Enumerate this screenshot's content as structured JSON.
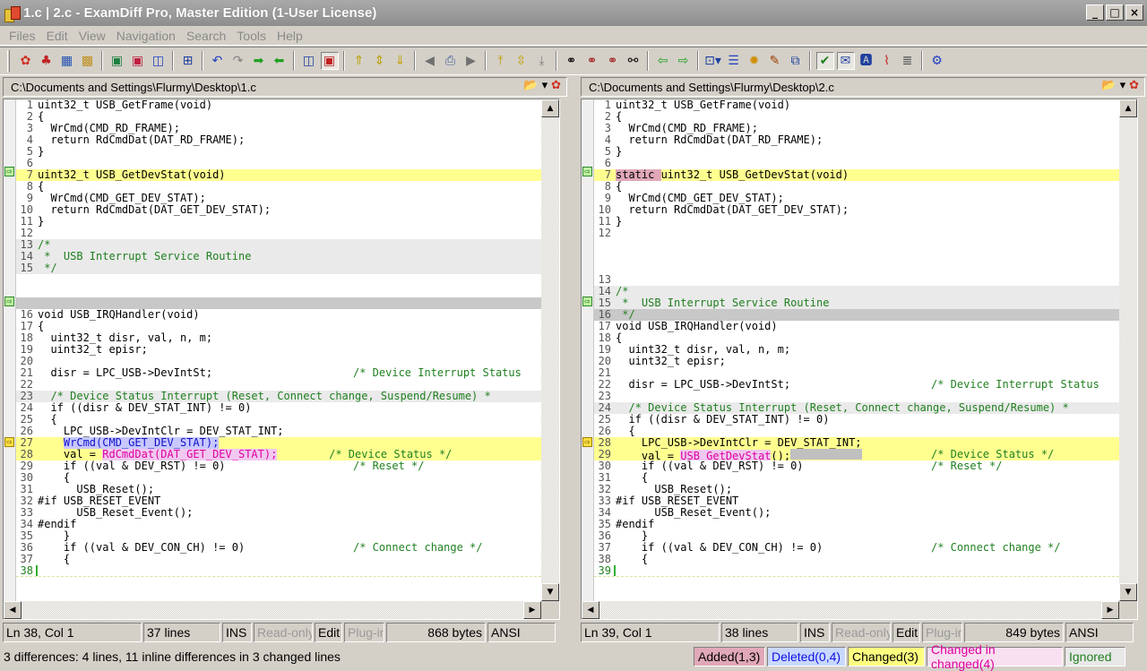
{
  "window": {
    "title": "1.c  |  2.c - ExamDiff Pro, Master Edition (1-User License)",
    "controls": {
      "minimize": "_",
      "maximize": "□",
      "close": "×"
    }
  },
  "menu": [
    "Files",
    "Edit",
    "View",
    "Navigation",
    "Search",
    "Tools",
    "Help"
  ],
  "toolbar_icons": [
    "compare-icon",
    "recompare-icon",
    "open-files-icon",
    "open-dirs-icon",
    "save-icon",
    "save-as-icon",
    "save-both-icon",
    "view-options-icon",
    "undo-icon",
    "redo-icon",
    "copy-right-icon",
    "copy-left-icon",
    "two-panes-icon",
    "one-pane-icon",
    "first-diff-icon",
    "current-diff-icon",
    "next-diff-bottom-icon",
    "prev-icon",
    "print-icon",
    "next-icon",
    "top-icon",
    "center-icon",
    "bottom-icon",
    "find-icon",
    "find-next-icon",
    "find-prev-icon",
    "replace-icon",
    "go-left-icon",
    "go-right-icon",
    "options-dropdown-icon",
    "lines-icon",
    "settings-icon",
    "edit-icon",
    "plugin-icon",
    "check-icon",
    "comment-icon",
    "font-icon",
    "whitespace-icon",
    "filter-icon",
    "config-icon"
  ],
  "left": {
    "path": "C:\\Documents and Settings\\Flurmy\\Desktop\\1.c",
    "lines": [
      {
        "n": "1",
        "t": "uint32_t USB_GetFrame(void)"
      },
      {
        "n": "2",
        "t": "{"
      },
      {
        "n": "3",
        "t": "  WrCmd(CMD_RD_FRAME);"
      },
      {
        "n": "4",
        "t": "  return RdCmdDat(DAT_RD_FRAME);"
      },
      {
        "n": "5",
        "t": "}"
      },
      {
        "n": "6",
        "t": ""
      },
      {
        "n": "7",
        "t": "uint32_t USB_GetDevStat(void)"
      },
      {
        "n": "8",
        "t": "{"
      },
      {
        "n": "9",
        "t": "  WrCmd(CMD_GET_DEV_STAT);"
      },
      {
        "n": "10",
        "t": "  return RdCmdDat(DAT_GET_DEV_STAT);"
      },
      {
        "n": "11",
        "t": "}"
      },
      {
        "n": "12",
        "t": ""
      },
      {
        "n": "13",
        "t": "/*"
      },
      {
        "n": "14",
        "t": " *  USB Interrupt Service Routine"
      },
      {
        "n": "15",
        "t": " */"
      },
      {
        "n": "16",
        "t": "void USB_IRQHandler(void)"
      },
      {
        "n": "17",
        "t": "{"
      },
      {
        "n": "18",
        "t": "  uint32_t disr, val, n, m;"
      },
      {
        "n": "19",
        "t": "  uint32_t episr;"
      },
      {
        "n": "20",
        "t": ""
      },
      {
        "n": "21",
        "t": "  disr = LPC_USB->DevIntSt;"
      },
      {
        "n": "21c",
        "t": "/* Device Interrupt Status"
      },
      {
        "n": "22",
        "t": ""
      },
      {
        "n": "23",
        "t": "  /* Device Status Interrupt (Reset, Connect change, Suspend/Resume) *"
      },
      {
        "n": "24",
        "t": "  if ((disr & DEV_STAT_INT) != 0)"
      },
      {
        "n": "25",
        "t": "  {"
      },
      {
        "n": "26",
        "t": "    LPC_USB->DevIntClr = DEV_STAT_INT;"
      },
      {
        "n": "27",
        "t": "WrCmd(CMD_GET_DEV_STAT);"
      },
      {
        "n": "28a",
        "t": "RdCmdDat(DAT_GET_DEV_STAT);"
      },
      {
        "n": "28b",
        "t": "    val = "
      },
      {
        "n": "28c",
        "t": "        /* Device Status */"
      },
      {
        "n": "29",
        "t": "    if ((val & DEV_RST) != 0)"
      },
      {
        "n": "29c",
        "t": "/* Reset */"
      },
      {
        "n": "30",
        "t": "    {"
      },
      {
        "n": "31",
        "t": "      USB_Reset();"
      },
      {
        "n": "32",
        "t": "#if USB_RESET_EVENT"
      },
      {
        "n": "33",
        "t": "      USB_Reset_Event();"
      },
      {
        "n": "34",
        "t": "#endif"
      },
      {
        "n": "35",
        "t": "    }"
      },
      {
        "n": "36",
        "t": "    if ((val & DEV_CON_CH) != 0)"
      },
      {
        "n": "36c",
        "t": "/* Connect change */"
      },
      {
        "n": "37",
        "t": "    {"
      },
      {
        "n": "38",
        "t": ""
      }
    ]
  },
  "right": {
    "path": "C:\\Documents and Settings\\Flurmy\\Desktop\\2.c",
    "lines": [
      {
        "n": "1",
        "t": "uint32_t USB_GetFrame(void)"
      },
      {
        "n": "2",
        "t": "{"
      },
      {
        "n": "3",
        "t": "  WrCmd(CMD_RD_FRAME);"
      },
      {
        "n": "4",
        "t": "  return RdCmdDat(DAT_RD_FRAME);"
      },
      {
        "n": "5",
        "t": "}"
      },
      {
        "n": "6",
        "t": ""
      },
      {
        "n": "7a",
        "t": "static "
      },
      {
        "n": "7b",
        "t": "uint32_t USB_GetDevStat(void)"
      },
      {
        "n": "8",
        "t": "{"
      },
      {
        "n": "9",
        "t": "  WrCmd(CMD_GET_DEV_STAT);"
      },
      {
        "n": "10",
        "t": "  return RdCmdDat(DAT_GET_DEV_STAT);"
      },
      {
        "n": "11",
        "t": "}"
      },
      {
        "n": "12",
        "t": ""
      },
      {
        "n": "13",
        "t": ""
      },
      {
        "n": "14",
        "t": "/*"
      },
      {
        "n": "15",
        "t": " *  USB Interrupt Service Routine"
      },
      {
        "n": "16",
        "t": " */"
      },
      {
        "n": "17",
        "t": "void USB_IRQHandler(void)"
      },
      {
        "n": "18",
        "t": "{"
      },
      {
        "n": "19",
        "t": "  uint32_t disr, val, n, m;"
      },
      {
        "n": "20",
        "t": "  uint32_t episr;"
      },
      {
        "n": "21",
        "t": ""
      },
      {
        "n": "22",
        "t": "  disr = LPC_USB->DevIntSt;"
      },
      {
        "n": "22c",
        "t": "/* Device Interrupt Status"
      },
      {
        "n": "23",
        "t": ""
      },
      {
        "n": "24",
        "t": "  /* Device Status Interrupt (Reset, Connect change, Suspend/Resume) *"
      },
      {
        "n": "25",
        "t": "  if ((disr & DEV_STAT_INT) != 0)"
      },
      {
        "n": "26",
        "t": "  {"
      },
      {
        "n": "27",
        "t": "    LPC_USB->DevIntClr = DEV_STAT_INT;"
      },
      {
        "n": "28",
        "t": ""
      },
      {
        "n": "29a",
        "t": "    val = "
      },
      {
        "n": "29b",
        "t": "USB_GetDevStat"
      },
      {
        "n": "29c",
        "t": "();"
      },
      {
        "n": "29d",
        "t": "/* Device Status */"
      },
      {
        "n": "30",
        "t": "    if ((val & DEV_RST) != 0)"
      },
      {
        "n": "30c",
        "t": "/* Reset */"
      },
      {
        "n": "31",
        "t": "    {"
      },
      {
        "n": "32",
        "t": "      USB_Reset();"
      },
      {
        "n": "33",
        "t": "#if USB_RESET_EVENT"
      },
      {
        "n": "34",
        "t": "      USB_Reset_Event();"
      },
      {
        "n": "35",
        "t": "#endif"
      },
      {
        "n": "36",
        "t": "    }"
      },
      {
        "n": "37",
        "t": "    if ((val & DEV_CON_CH) != 0)"
      },
      {
        "n": "37c",
        "t": "/* Connect change */"
      },
      {
        "n": "38",
        "t": "    {"
      },
      {
        "n": "39",
        "t": ""
      }
    ]
  },
  "status_left": {
    "pos": "Ln 38, Col 1",
    "lines": "37 lines",
    "ins": "INS",
    "ro": "Read-only",
    "edit": "Edit",
    "plugin": "Plug-in",
    "bytes": "868 bytes",
    "enc": "ANSI"
  },
  "status_right": {
    "pos": "Ln 39, Col 1",
    "lines": "38 lines",
    "ins": "INS",
    "ro": "Read-only",
    "edit": "Edit",
    "plugin": "Plug-in",
    "bytes": "849 bytes",
    "enc": "ANSI"
  },
  "bottom": {
    "message": "3 differences: 4 lines, 11 inline differences in 3 changed lines",
    "added": "Added(1,3)",
    "deleted": "Deleted(0,4)",
    "changed": "Changed(3)",
    "changed_in_changed": "Changed in changed(4)",
    "ignored": "Ignored"
  },
  "colors": {
    "changed": "#ffff90",
    "added_legend": "#e0a8b8",
    "deleted_legend": "#1010e0",
    "ignored": "#208020"
  }
}
